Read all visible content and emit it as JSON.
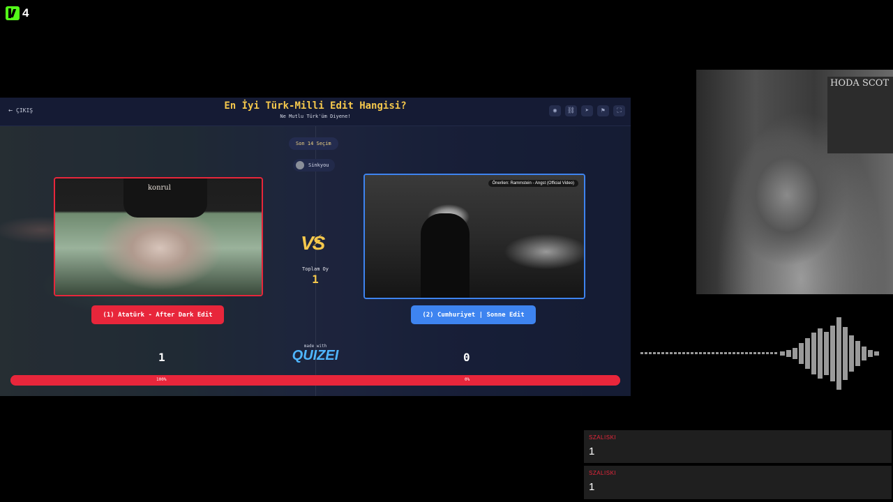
{
  "overlay": {
    "logo_number": "4"
  },
  "quiz": {
    "exit_label": "ÇIKIŞ",
    "title": "En İyi Türk-Milli Edit Hangisi?",
    "subtitle": "Ne Mutlu Türk'üm Diyene!",
    "header_icons": [
      "eye-icon",
      "link-icon",
      "send-icon",
      "flag-icon",
      "fullscreen-icon"
    ],
    "round_label": "Son 14 Seçim",
    "user": "Sinkyou",
    "left": {
      "video_watermark": "konrul",
      "choice_label": "(1) Atatürk - After Dark Edit",
      "score": "1",
      "percent": "100%",
      "color": "#e8263b"
    },
    "right": {
      "video_overlay": "Önerilen: Rammstein - Angst (Official Video)",
      "choice_label": "(2) Cumhuriyet | Sonne Edit",
      "score": "0",
      "percent": "0%",
      "color": "#3e84f0"
    },
    "vs_label": "VS",
    "total_label": "Toplam Oy",
    "total_votes": "1",
    "made_with": "made with",
    "brand": "QUIZEI",
    "left_share": 1.0,
    "accent": "#f5c84c"
  },
  "webcam": {
    "poster_text": "HODA SCOT"
  },
  "chat": [
    {
      "user": "SZALISKI",
      "message": "1"
    },
    {
      "user": "SZALISKI",
      "message": "1"
    }
  ]
}
